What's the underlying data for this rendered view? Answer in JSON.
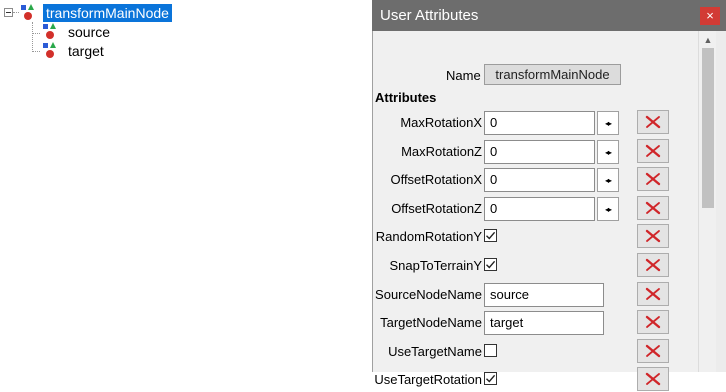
{
  "tree": {
    "root": {
      "label": "transformMainNode",
      "icon": "node-icon"
    },
    "children": [
      {
        "label": "source",
        "icon": "node-icon"
      },
      {
        "label": "target",
        "icon": "node-icon"
      }
    ]
  },
  "panel": {
    "title": "User Attributes",
    "close_icon": "×",
    "name_label": "Name",
    "name_value": "transformMainNode",
    "section_title": "Attributes",
    "attributes": [
      {
        "label": "MaxRotationX",
        "type": "number",
        "value": "0",
        "spin_icon": "◂▸"
      },
      {
        "label": "MaxRotationZ",
        "type": "number",
        "value": "0",
        "spin_icon": "◂▸"
      },
      {
        "label": "OffsetRotationX",
        "type": "number",
        "value": "0",
        "spin_icon": "◂▸"
      },
      {
        "label": "OffsetRotationZ",
        "type": "number",
        "value": "0",
        "spin_icon": "◂▸"
      },
      {
        "label": "RandomRotationY",
        "type": "checkbox",
        "checked": true
      },
      {
        "label": "SnapToTerrainY",
        "type": "checkbox",
        "checked": true
      },
      {
        "label": "SourceNodeName",
        "type": "text",
        "value": "source"
      },
      {
        "label": "TargetNodeName",
        "type": "text",
        "value": "target"
      },
      {
        "label": "UseTargetName",
        "type": "checkbox",
        "checked": false
      },
      {
        "label": "UseTargetRotation",
        "type": "checkbox",
        "checked": true
      }
    ]
  },
  "colors": {
    "selection": "#0a74da",
    "titlebar": "#6d6d6d",
    "close": "#d23b35",
    "delete_x": "#d0262a"
  }
}
